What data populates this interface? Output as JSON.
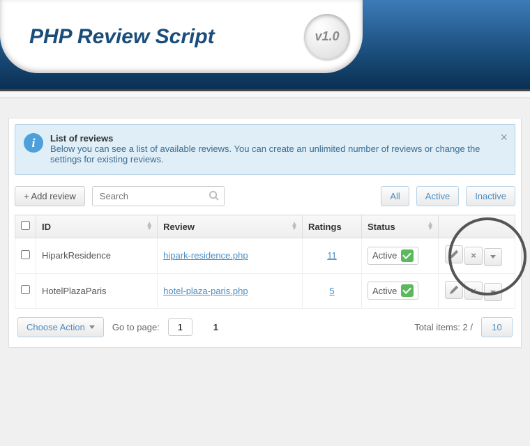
{
  "header": {
    "title": "PHP Review Script",
    "version": "v1.0"
  },
  "info": {
    "title": "List of reviews",
    "text": "Below you can see a list of available reviews. You can create an unlimited number of reviews or change the settings for existing reviews."
  },
  "toolbar": {
    "add": "+ Add review",
    "search_placeholder": "Search",
    "filters": {
      "all": "All",
      "active": "Active",
      "inactive": "Inactive"
    }
  },
  "columns": {
    "id": "ID",
    "review": "Review",
    "ratings": "Ratings",
    "status": "Status"
  },
  "rows": [
    {
      "id": "HiparkResidence",
      "review": "hipark-residence.php",
      "ratings": "11",
      "status": "Active"
    },
    {
      "id": "HotelPlazaParis",
      "review": "hotel-plaza-paris.php",
      "ratings": "5",
      "status": "Active"
    }
  ],
  "footer": {
    "choose_action": "Choose Action",
    "goto": "Go to page:",
    "page_value": "1",
    "current_page": "1",
    "total_items_label": "Total items: 2 /",
    "per_page": "10"
  }
}
